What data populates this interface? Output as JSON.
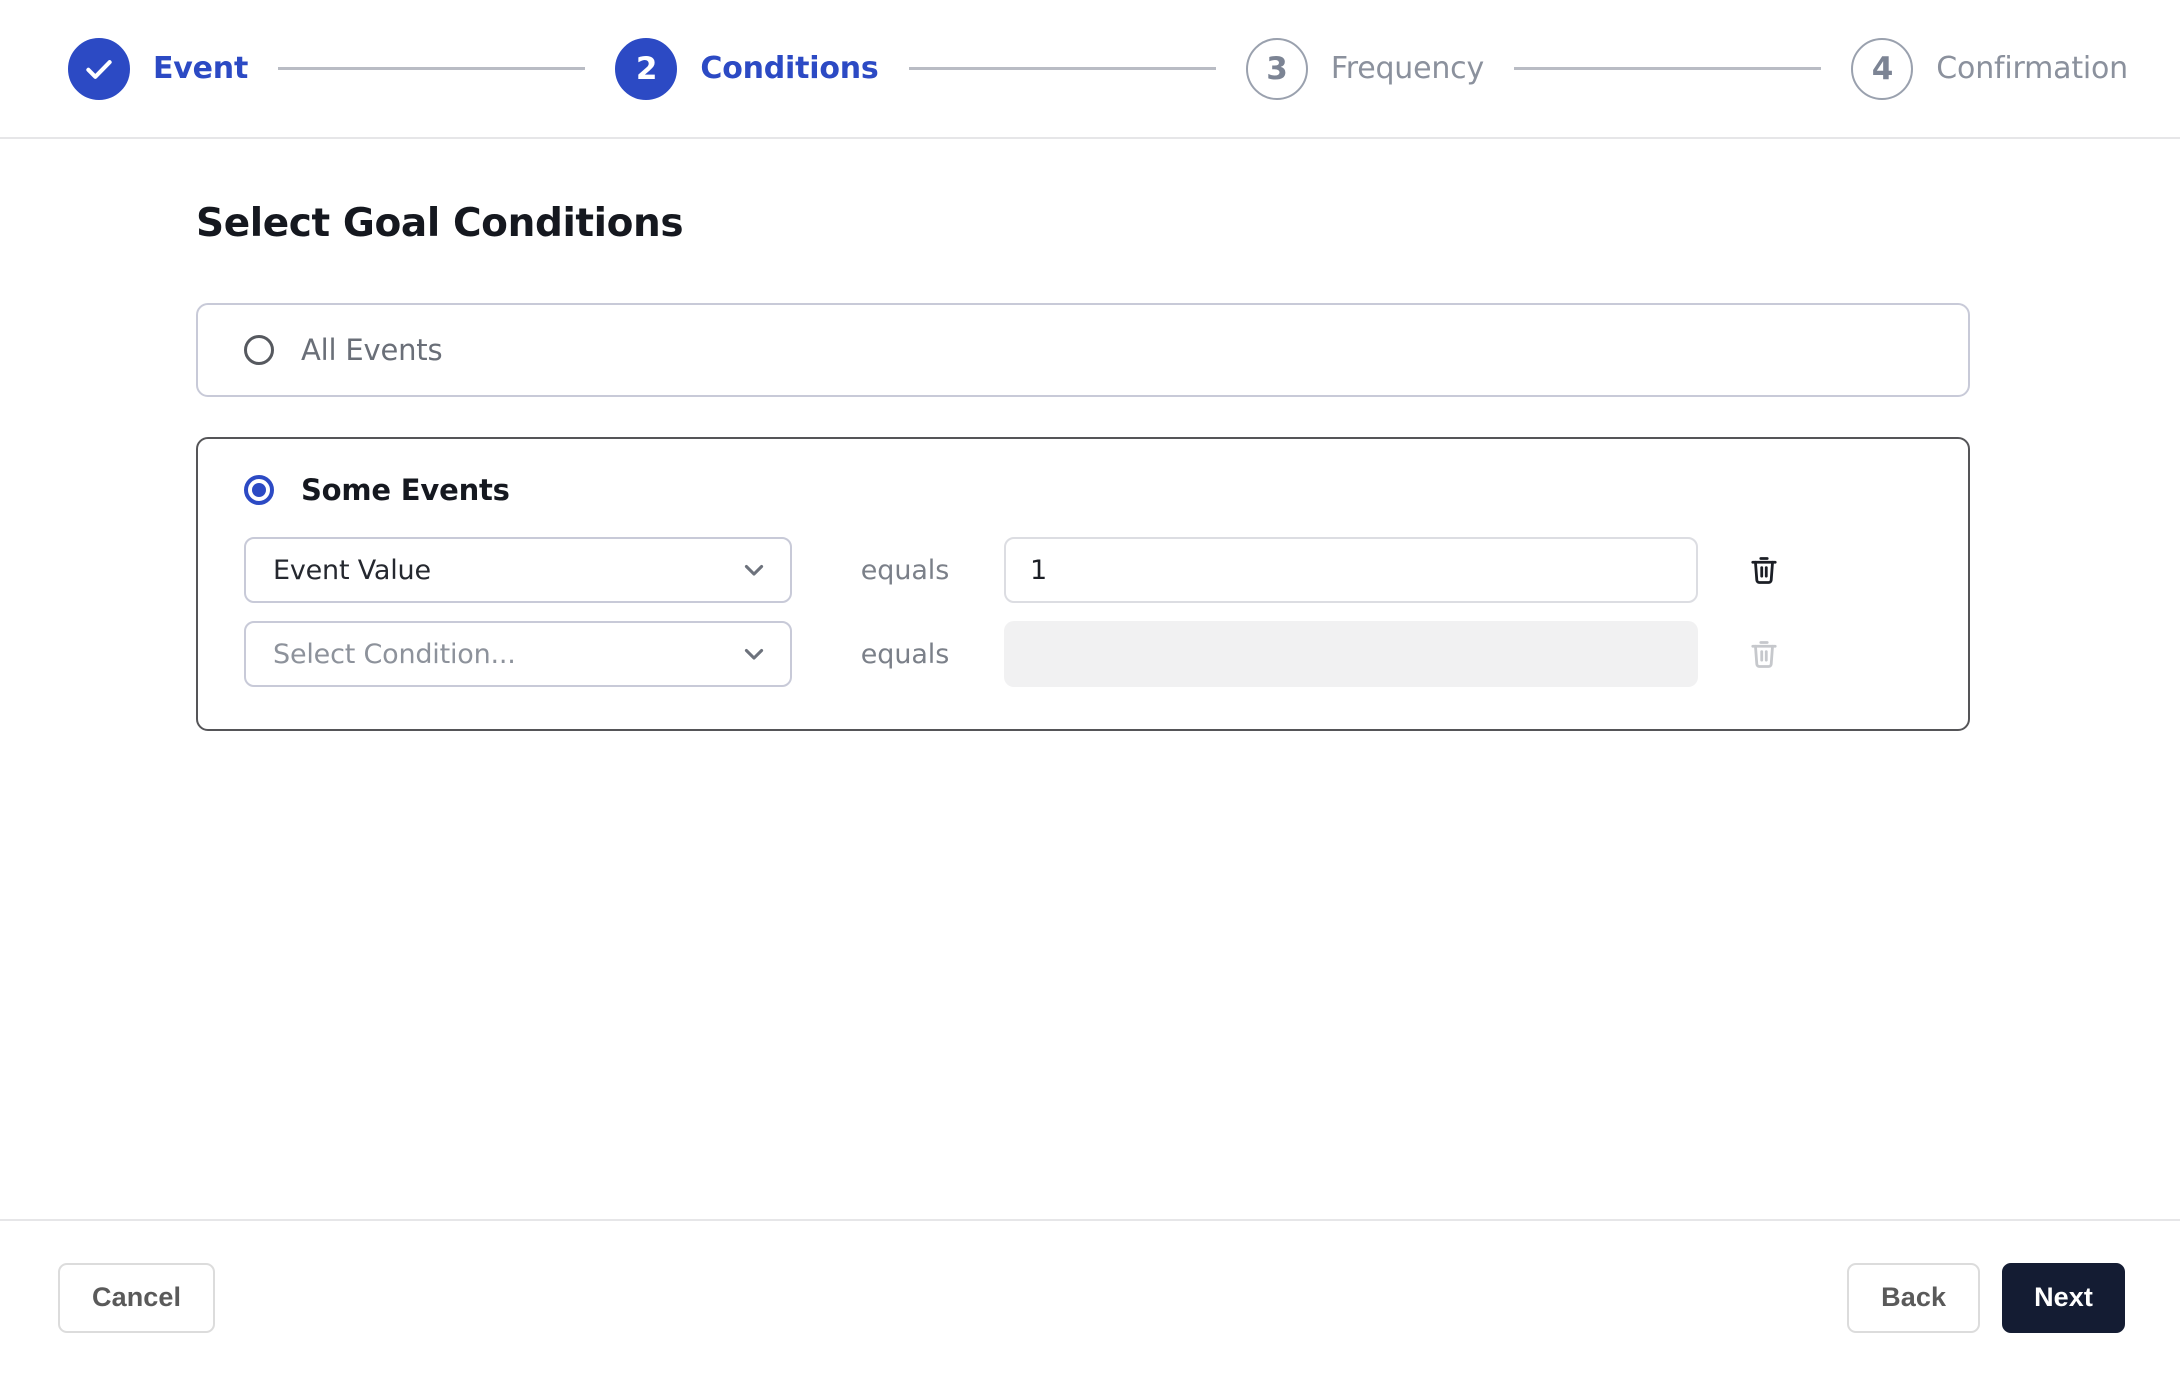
{
  "stepper": {
    "steps": [
      {
        "num": "1",
        "label": "Event",
        "state": "done",
        "icon": "check-icon"
      },
      {
        "num": "2",
        "label": "Conditions",
        "state": "active",
        "icon": ""
      },
      {
        "num": "3",
        "label": "Frequency",
        "state": "todo",
        "icon": ""
      },
      {
        "num": "4",
        "label": "Confirmation",
        "state": "todo",
        "icon": ""
      }
    ]
  },
  "main": {
    "title": "Select Goal Conditions",
    "options": [
      {
        "id": "all-events",
        "label": "All Events",
        "selected": false
      },
      {
        "id": "some-events",
        "label": "Some Events",
        "selected": true
      }
    ],
    "conditions": [
      {
        "field": "Event Value",
        "field_is_placeholder": false,
        "operator": "equals",
        "value": "1",
        "value_placeholder": "",
        "value_disabled": false,
        "delete_enabled": true
      },
      {
        "field": "Select Condition...",
        "field_is_placeholder": true,
        "operator": "equals",
        "value": "",
        "value_placeholder": "",
        "value_disabled": true,
        "delete_enabled": false
      }
    ]
  },
  "footer": {
    "cancel_label": "Cancel",
    "back_label": "Back",
    "next_label": "Next"
  },
  "colors": {
    "accent_blue": "#2c4ac4",
    "primary_button": "#141c33",
    "muted_text": "#8b919d",
    "active_card_border": "#555558",
    "inactive_card_border": "#c8cad8",
    "disabled_field": "#f1f1f2"
  }
}
